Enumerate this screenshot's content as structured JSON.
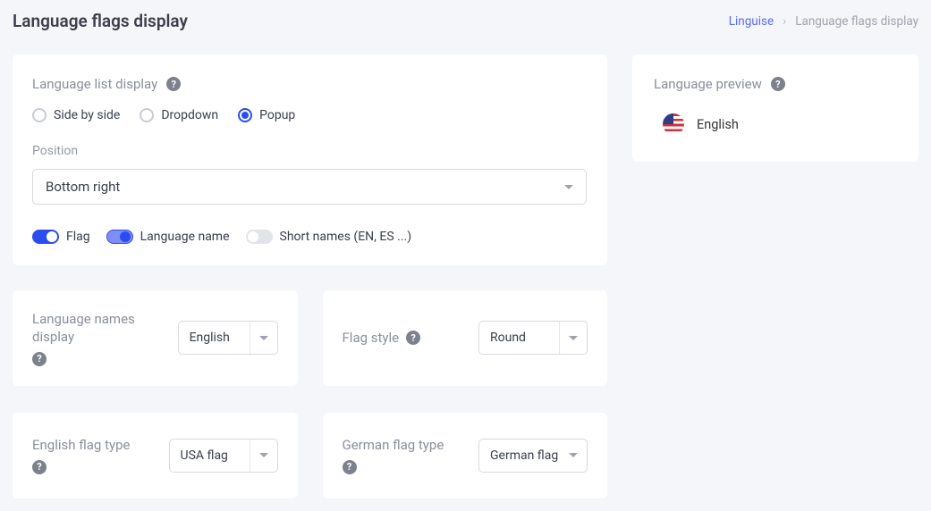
{
  "header": {
    "title": "Language flags display",
    "breadcrumb": {
      "root": "Linguise",
      "current": "Language flags display"
    }
  },
  "list_display": {
    "label": "Language list display",
    "options": [
      "Side by side",
      "Dropdown",
      "Popup"
    ],
    "selected": "Popup",
    "position_label": "Position",
    "position_value": "Bottom right",
    "toggles": {
      "flag": {
        "label": "Flag",
        "value": true
      },
      "language_name": {
        "label": "Language name",
        "value": true
      },
      "short_names": {
        "label": "Short names (EN, ES ...)",
        "value": false
      }
    }
  },
  "cards": {
    "names_display": {
      "label": "Language names display",
      "value": "English"
    },
    "flag_style": {
      "label": "Flag style",
      "value": "Round"
    },
    "english_flag": {
      "label": "English flag type",
      "value": "USA flag"
    },
    "german_flag": {
      "label": "German flag type",
      "value": "German flag"
    }
  },
  "preview": {
    "label": "Language preview",
    "item": "English"
  }
}
